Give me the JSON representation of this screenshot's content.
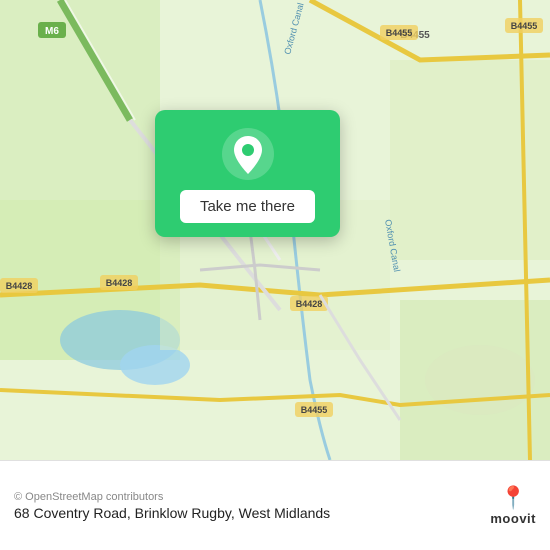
{
  "map": {
    "background_color": "#e8f0d8"
  },
  "card": {
    "button_label": "Take me there"
  },
  "bottom_bar": {
    "osm_credit": "© OpenStreetMap contributors",
    "address": "68 Coventry Road, Brinklow Rugby, West Midlands",
    "moovit_label": "moovit"
  },
  "road_labels": {
    "m6": "M6",
    "b4455_top": "B4455",
    "b4455_right": "B4455",
    "b4455_bottom": "B4455",
    "b4428_left": "B4428",
    "b4428_center": "B4428",
    "oxford_canal_top": "Oxford Canal",
    "oxford_canal_right": "Oxford Canal"
  }
}
